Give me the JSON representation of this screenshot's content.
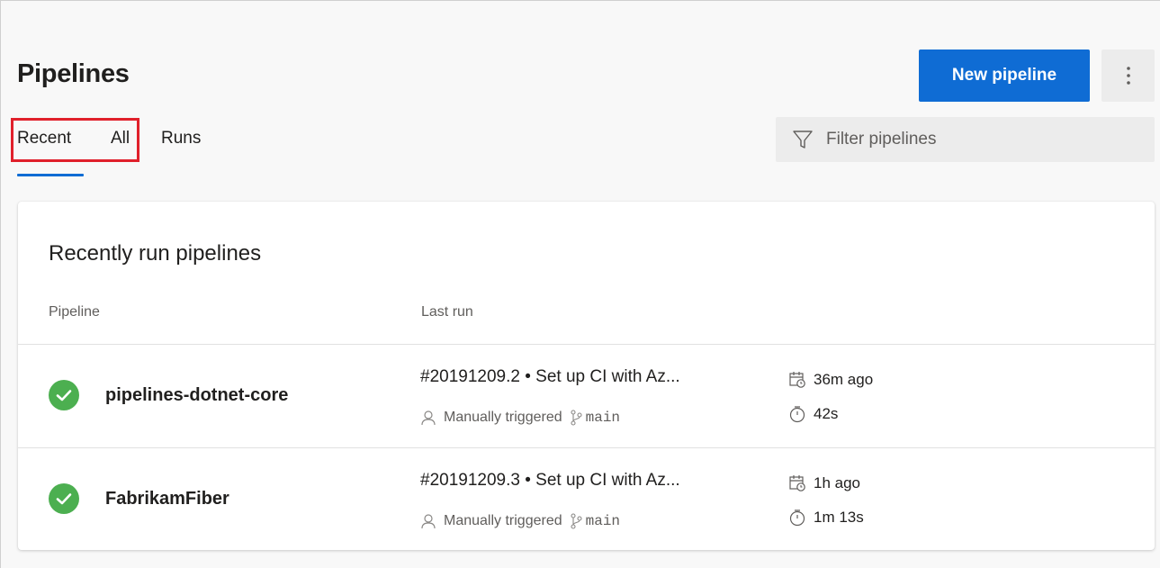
{
  "header": {
    "title": "Pipelines",
    "new_pipeline_label": "New pipeline"
  },
  "tabs": [
    {
      "label": "Recent",
      "selected": true
    },
    {
      "label": "All",
      "selected": false
    },
    {
      "label": "Runs",
      "selected": false
    }
  ],
  "filter": {
    "placeholder": "Filter pipelines",
    "value": ""
  },
  "recent_card": {
    "title": "Recently run pipelines",
    "columns": [
      "Pipeline",
      "Last run"
    ],
    "rows": [
      {
        "status": "succeeded",
        "name": "pipelines-dotnet-core",
        "run_title": "#20191209.2 • Set up CI with Az...",
        "trigger": "Manually triggered",
        "branch": "main",
        "time_ago": "36m ago",
        "duration": "42s"
      },
      {
        "status": "succeeded",
        "name": "FabrikamFiber",
        "run_title": "#20191209.3 • Set up CI with Az...",
        "trigger": "Manually triggered",
        "branch": "main",
        "time_ago": "1h ago",
        "duration": "1m 13s"
      }
    ]
  },
  "colors": {
    "accent": "#0f6cd4",
    "success": "#4caf50",
    "highlight": "#e0202b",
    "background": "#f8f8f8"
  },
  "icons": {
    "more": "more-vertical-icon",
    "filter": "filter-icon",
    "status": "check-circle-icon",
    "user": "person-icon",
    "branch": "branch-icon",
    "calendar": "calendar-clock-icon",
    "duration": "stopwatch-icon"
  }
}
